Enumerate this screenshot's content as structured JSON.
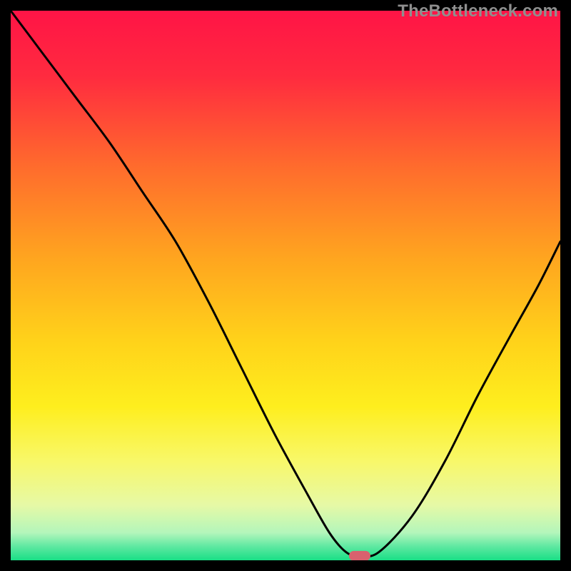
{
  "watermark": "TheBottleneck.com",
  "accent_marker_color": "#d9616e",
  "curve_color": "#000000",
  "chart_data": {
    "type": "line",
    "title": "",
    "xlabel": "",
    "ylabel": "",
    "xlim": [
      0,
      100
    ],
    "ylim": [
      0,
      100
    ],
    "gradient_stops": [
      {
        "offset": 0.0,
        "color": "#ff1446"
      },
      {
        "offset": 0.12,
        "color": "#ff2b3f"
      },
      {
        "offset": 0.28,
        "color": "#ff6a2d"
      },
      {
        "offset": 0.45,
        "color": "#ffa51f"
      },
      {
        "offset": 0.6,
        "color": "#ffd21a"
      },
      {
        "offset": 0.72,
        "color": "#feee1e"
      },
      {
        "offset": 0.82,
        "color": "#f8f86a"
      },
      {
        "offset": 0.9,
        "color": "#e6f9a6"
      },
      {
        "offset": 0.95,
        "color": "#b3f6bb"
      },
      {
        "offset": 0.975,
        "color": "#5ee8a1"
      },
      {
        "offset": 1.0,
        "color": "#19df86"
      }
    ],
    "series": [
      {
        "name": "bottleneck-curve",
        "x": [
          0,
          6,
          12,
          18,
          24,
          30,
          36,
          42,
          48,
          54,
          58,
          61,
          63.5,
          67,
          73,
          79,
          85,
          91,
          96,
          100
        ],
        "y": [
          100,
          92,
          84,
          76,
          67,
          58,
          47,
          35,
          23,
          12,
          5,
          1.5,
          0.8,
          1.5,
          8,
          18,
          30,
          41,
          50,
          58
        ]
      }
    ],
    "marker": {
      "x": 63.5,
      "y": 0.8
    }
  }
}
